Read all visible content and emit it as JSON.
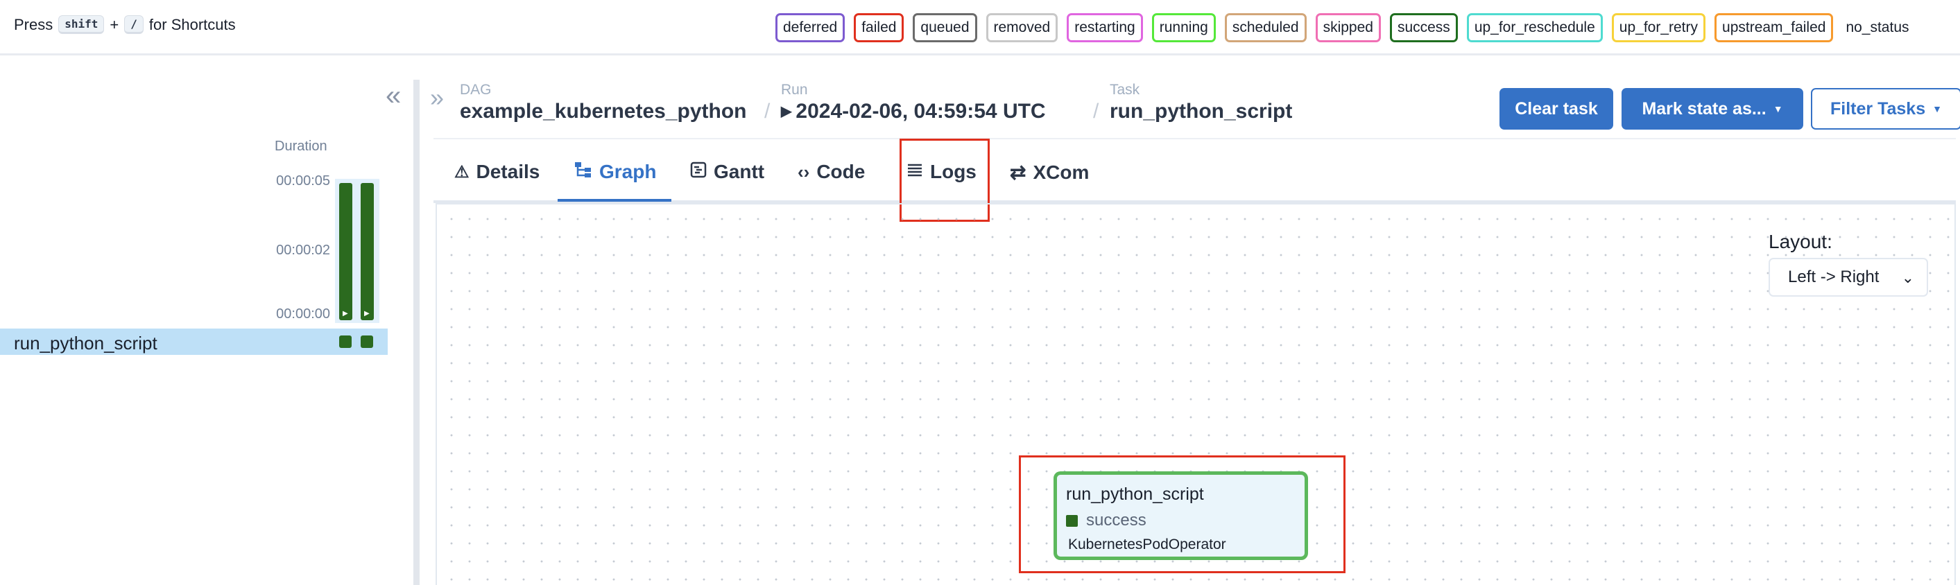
{
  "shortcuts": {
    "press": "Press",
    "key1": "shift",
    "plus": "+",
    "key2": "/",
    "suffix": "for Shortcuts"
  },
  "legend": [
    {
      "label": "deferred",
      "color": "#7d5bd0"
    },
    {
      "label": "failed",
      "color": "#e0301e"
    },
    {
      "label": "queued",
      "color": "#6b6b6b"
    },
    {
      "label": "removed",
      "color": "#c8c8c8"
    },
    {
      "label": "restarting",
      "color": "#e066e0"
    },
    {
      "label": "running",
      "color": "#55e83a"
    },
    {
      "label": "scheduled",
      "color": "#d2a679"
    },
    {
      "label": "skipped",
      "color": "#f06fb4"
    },
    {
      "label": "success",
      "color": "#1f6e1f"
    },
    {
      "label": "up_for_reschedule",
      "color": "#4fdbd0"
    },
    {
      "label": "up_for_retry",
      "color": "#f7d23a"
    },
    {
      "label": "upstream_failed",
      "color": "#f79a2d"
    },
    {
      "label": "no_status",
      "color": ""
    }
  ],
  "grid": {
    "duration_label": "Duration",
    "ticks": [
      "00:00:05",
      "00:00:02",
      "00:00:00"
    ],
    "task_name": "run_python_script",
    "run_states": [
      "success",
      "success"
    ]
  },
  "breadcrumb": {
    "dag_label": "DAG",
    "dag_value": "example_kubernetes_python",
    "run_label": "Run",
    "run_value": "2024-02-06, 04:59:54 UTC",
    "task_label": "Task",
    "task_value": "run_python_script"
  },
  "actions": {
    "clear": "Clear task",
    "mark": "Mark state as...",
    "filter": "Filter Tasks"
  },
  "tabs": [
    {
      "label": "Details",
      "icon": "warning-icon"
    },
    {
      "label": "Graph",
      "icon": "graph-icon",
      "active": true
    },
    {
      "label": "Gantt",
      "icon": "gantt-icon"
    },
    {
      "label": "Code",
      "icon": "code-icon"
    },
    {
      "label": "Logs",
      "icon": "logs-icon"
    },
    {
      "label": "XCom",
      "icon": "exchange-icon"
    }
  ],
  "layout": {
    "label": "Layout:",
    "value": "Left -> Right"
  },
  "node": {
    "title": "run_python_script",
    "state": "success",
    "operator": "KubernetesPodOperator",
    "border_color": "#5cb85c"
  }
}
